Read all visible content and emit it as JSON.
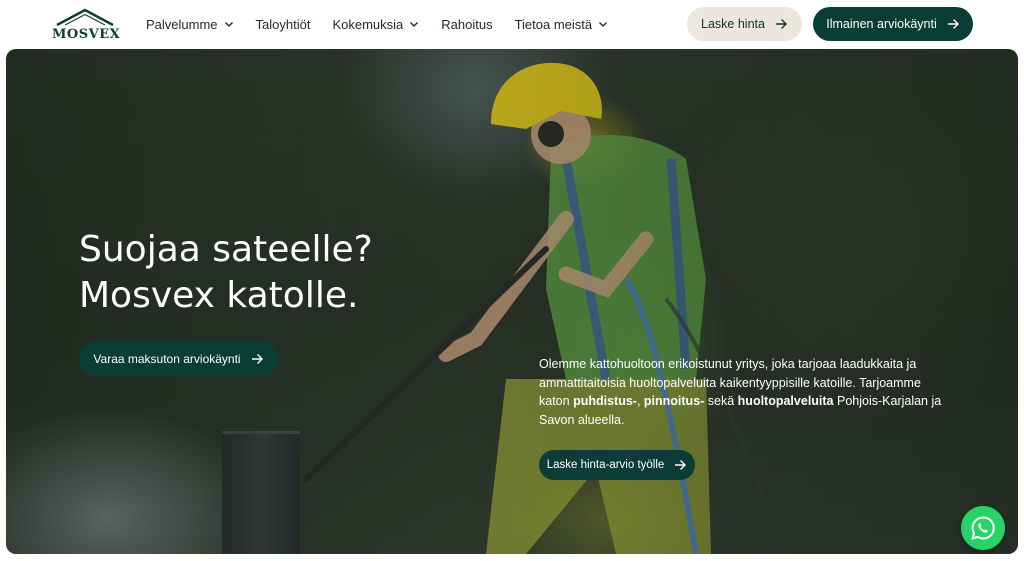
{
  "brand": {
    "name": "MOSVEX",
    "color": "#0b3b34",
    "icon": "house-roof-logo-icon"
  },
  "nav": {
    "items": [
      {
        "label": "Palvelumme",
        "has_dropdown": true
      },
      {
        "label": "Taloyhtiöt",
        "has_dropdown": false
      },
      {
        "label": "Kokemuksia",
        "has_dropdown": true
      },
      {
        "label": "Rahoitus",
        "has_dropdown": false
      },
      {
        "label": "Tietoa meistä",
        "has_dropdown": true
      }
    ]
  },
  "header_actions": {
    "calc_label": "Laske hinta",
    "visit_label": "Ilmainen arviokäynti"
  },
  "hero": {
    "title_line1": "Suojaa sateelle?",
    "title_line2": "Mosvex katolle.",
    "cta_label": "Varaa maksuton arviokäynti",
    "desc_1": "Olemme kattohuoltoon erikoistunut yritys, joka tarjoaa laadukkaita ja ammattitaitoisia huoltopalveluita kaikentyyppisille katoille. Tarjoamme katon ",
    "desc_b1": "puhdistus-",
    "desc_sep": ", ",
    "desc_b2": "pinnoitus-",
    "desc_2": " sekä  ",
    "desc_b3": "huoltopalveluita",
    "desc_3": " Pohjois-Karjalan ja Savon alueella.",
    "secondary_cta_label": "Laske hinta-arvio työlle"
  },
  "colors": {
    "primary": "#0a3d35",
    "secondary_button": "#ece6dc",
    "whatsapp": "#25d366"
  },
  "icons": {
    "dropdown": "chevron-down-icon",
    "arrow": "arrow-right-icon",
    "chat": "whatsapp-icon"
  }
}
